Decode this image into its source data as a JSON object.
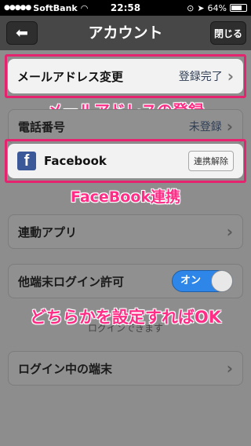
{
  "statusbar": {
    "carrier": "SoftBank",
    "time": "22:58",
    "battery": "64%",
    "battery_level": 0.64
  },
  "navbar": {
    "back_icon": "arrow-left-icon",
    "title": "アカウント",
    "close_label": "閉じる"
  },
  "rows": {
    "email": {
      "label": "メールアドレス変更",
      "value": "登録完了"
    },
    "phone": {
      "label": "電話番号",
      "value": "未登録"
    },
    "facebook": {
      "label": "Facebook",
      "button": "連携解除"
    },
    "apps": {
      "label": "連動アプリ"
    },
    "other_login": {
      "label": "他端末ログイン許可",
      "toggle": "オン",
      "note": "ログインできます"
    },
    "devices": {
      "label": "ログイン中の端末"
    }
  },
  "captions": {
    "email": "メールアドレスの登録",
    "facebook": "FaceBook連携",
    "either": "どちらかを設定すればOK"
  },
  "colors": {
    "highlight": "#e6236f",
    "caption": "#ff2d86",
    "toggle_on": "#2e86e8",
    "facebook": "#3b5998"
  }
}
